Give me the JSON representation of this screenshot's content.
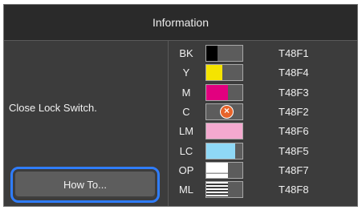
{
  "header": {
    "title": "Information"
  },
  "message": "Close Lock Switch.",
  "howto_button": {
    "label": "How To..."
  },
  "inks": [
    {
      "code": "BK",
      "part": "T48F1",
      "color": "#000000",
      "level": 0.3,
      "pattern": "solid",
      "error": false
    },
    {
      "code": "Y",
      "part": "T48F4",
      "color": "#f5e400",
      "level": 0.45,
      "pattern": "solid",
      "error": false
    },
    {
      "code": "M",
      "part": "T48F3",
      "color": "#e2007f",
      "level": 0.6,
      "pattern": "solid",
      "error": false
    },
    {
      "code": "C",
      "part": "T48F2",
      "color": "#5c5c5c",
      "level": 0,
      "pattern": "solid",
      "error": true,
      "error_icon": "x-circle-icon"
    },
    {
      "code": "LM",
      "part": "T48F6",
      "color": "#f4a9cf",
      "level": 1.0,
      "pattern": "solid",
      "error": false
    },
    {
      "code": "LC",
      "part": "T48F5",
      "color": "#8fd8f6",
      "level": 0.8,
      "pattern": "solid",
      "error": false
    },
    {
      "code": "OP",
      "part": "T48F7",
      "color": "#ffffff",
      "level": 0.6,
      "pattern": "op",
      "error": false
    },
    {
      "code": "ML",
      "part": "T48F8",
      "color": "#ffffff",
      "level": 0.6,
      "pattern": "ml",
      "error": false
    }
  ],
  "colors": {
    "accent": "#2f7dff",
    "background": "#3c3c3c"
  }
}
